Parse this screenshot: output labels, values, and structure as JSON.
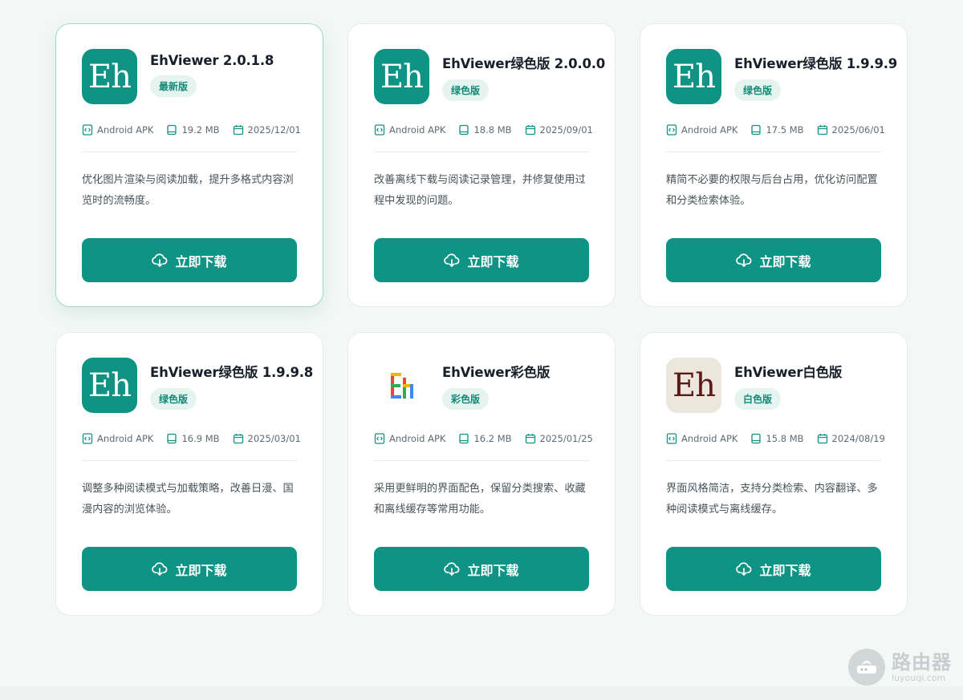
{
  "colors": {
    "accent": "#0f9384",
    "badge_bg": "#e6f4f0",
    "badge_text": "#118a76",
    "page_bg": "#f3f8f6"
  },
  "cards": [
    {
      "title": "EhViewer 2.0.1.8",
      "logo_text": "Eh",
      "logo_style": "green",
      "badge": "最新版",
      "platform": "Android APK",
      "size": "19.2 MB",
      "date": "2025/12/01",
      "description": "优化图片渲染与阅读加载，提升多格式内容浏览时的流畅度。",
      "button": "立即下载"
    },
    {
      "title": "EhViewer绿色版 2.0.0.0",
      "logo_text": "Eh",
      "logo_style": "green",
      "badge": "绿色版",
      "platform": "Android APK",
      "size": "18.8 MB",
      "date": "2025/09/01",
      "description": "改善离线下载与阅读记录管理，并修复使用过程中发现的问题。",
      "button": "立即下载"
    },
    {
      "title": "EhViewer绿色版 1.9.9.9",
      "logo_text": "Eh",
      "logo_style": "green",
      "badge": "绿色版",
      "platform": "Android APK",
      "size": "17.5 MB",
      "date": "2025/06/01",
      "description": "精简不必要的权限与后台占用，优化访问配置和分类检索体验。",
      "button": "立即下载"
    },
    {
      "title": "EhViewer绿色版 1.9.9.8",
      "logo_text": "Eh",
      "logo_style": "green",
      "badge": "绿色版",
      "platform": "Android APK",
      "size": "16.9 MB",
      "date": "2025/03/01",
      "description": "调整多种阅读模式与加载策略，改善日漫、国漫内容的浏览体验。",
      "button": "立即下载"
    },
    {
      "title": "EhViewer彩色版",
      "logo_text": "",
      "logo_style": "color",
      "badge": "彩色版",
      "platform": "Android APK",
      "size": "16.2 MB",
      "date": "2025/01/25",
      "description": "采用更鲜明的界面配色，保留分类搜索、收藏和离线缓存等常用功能。",
      "button": "立即下载"
    },
    {
      "title": "EhViewer白色版",
      "logo_text": "Eh",
      "logo_style": "white",
      "badge": "白色版",
      "platform": "Android APK",
      "size": "15.8 MB",
      "date": "2024/08/19",
      "description": "界面风格简洁，支持分类检索、内容翻译、多种阅读模式与离线缓存。",
      "button": "立即下载"
    }
  ],
  "watermark": {
    "name": "路由器",
    "url": "luyouqi.com"
  }
}
